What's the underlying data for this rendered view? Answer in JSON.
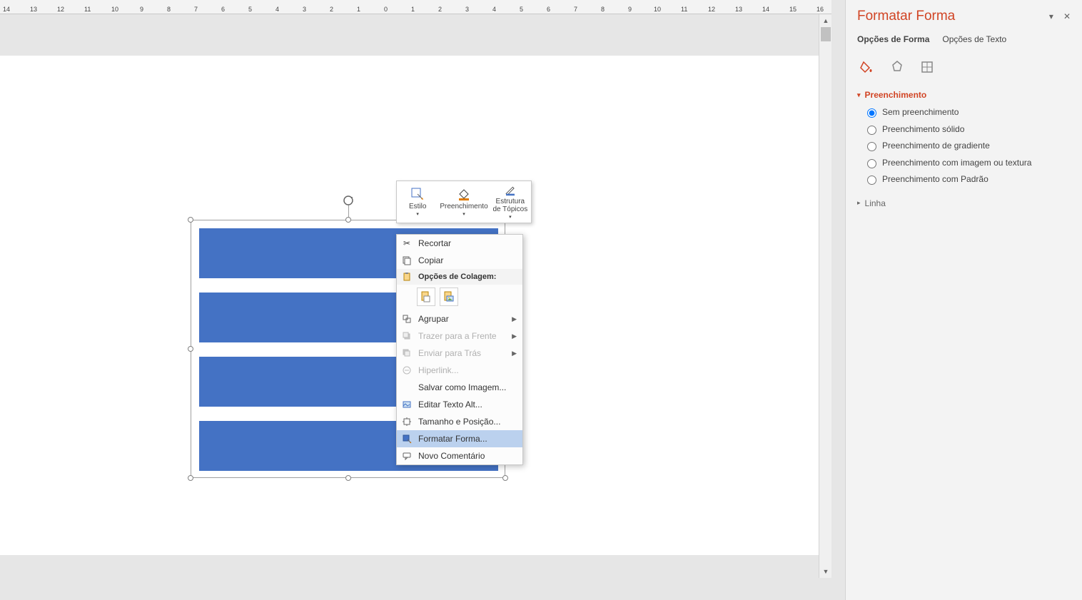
{
  "ruler": {
    "unit_range": [
      -14,
      -13,
      -12,
      -11,
      -10,
      -9,
      -8,
      -7,
      -6,
      -5,
      -4,
      -3,
      -2,
      -1,
      0,
      1,
      2,
      3,
      4,
      5,
      6,
      7,
      8,
      9,
      10,
      11,
      12,
      13,
      14,
      15,
      16
    ]
  },
  "mini_toolbar": {
    "style": "Estilo",
    "fill": "Preenchimento",
    "outline": "Estrutura de Tópicos"
  },
  "context_menu": {
    "cut": "Recortar",
    "copy": "Copiar",
    "paste_header": "Opções de Colagem:",
    "group": "Agrupar",
    "bring_front": "Trazer para a Frente",
    "send_back": "Enviar para Trás",
    "hyperlink": "Hiperlink...",
    "save_as_image": "Salvar como Imagem...",
    "edit_alt_text": "Editar Texto Alt...",
    "size_position": "Tamanho e Posição...",
    "format_shape": "Formatar Forma...",
    "new_comment": "Novo Comentário"
  },
  "sidebar": {
    "title": "Formatar Forma",
    "tabs": {
      "shape": "Opções de Forma",
      "text": "Opções de Texto"
    },
    "icons": {
      "fill": "fill-line-icon",
      "effects": "effects-icon",
      "size": "size-props-icon"
    },
    "fill": {
      "header": "Preenchimento",
      "no_fill": "Sem preenchimento",
      "solid": "Preenchimento sólido",
      "gradient": "Preenchimento de gradiente",
      "picture": "Preenchimento com imagem ou textura",
      "pattern": "Preenchimento com Padrão"
    },
    "line": {
      "header": "Linha"
    }
  }
}
